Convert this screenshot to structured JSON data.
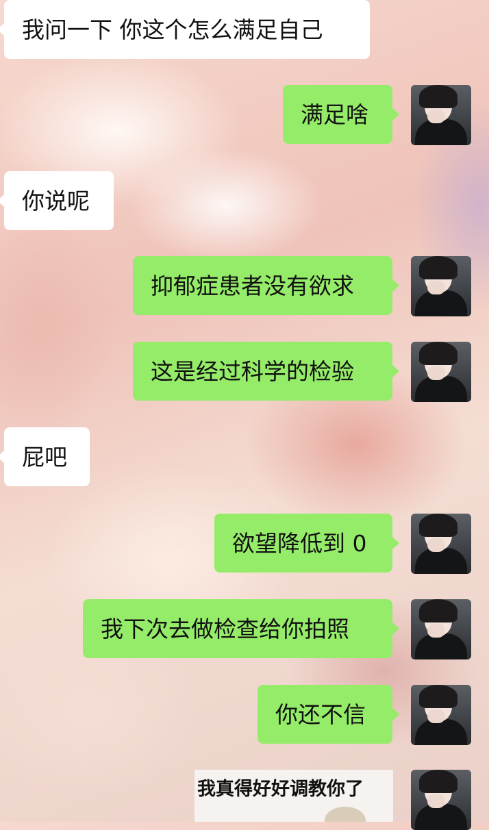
{
  "chat": {
    "messages": [
      {
        "side": "left",
        "text": "我问一下 你这个怎么满足自己"
      },
      {
        "side": "right",
        "text": "满足啥"
      },
      {
        "side": "left",
        "text": "你说呢"
      },
      {
        "side": "right",
        "text": "抑郁症患者没有欲求"
      },
      {
        "side": "right",
        "text": "这是经过科学的检验"
      },
      {
        "side": "left",
        "text": "屁吧"
      },
      {
        "side": "right",
        "text": "欲望降低到 0"
      },
      {
        "side": "right",
        "text": "我下次去做检查给你拍照"
      },
      {
        "side": "right",
        "text": "你还不信"
      }
    ],
    "sticker": {
      "text": "我真得好好调教你了"
    }
  },
  "colors": {
    "self_bubble": "#95ec69",
    "other_bubble": "#ffffff"
  }
}
